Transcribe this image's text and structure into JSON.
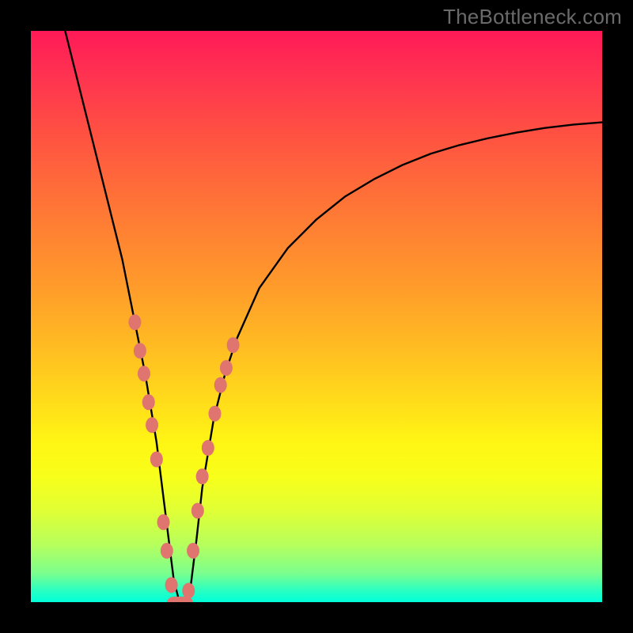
{
  "watermark": "TheBottleneck.com",
  "chart_data": {
    "type": "line",
    "title": "",
    "xlabel": "",
    "ylabel": "",
    "xlim": [
      0,
      100
    ],
    "ylim": [
      0,
      100
    ],
    "series": [
      {
        "name": "curve",
        "x": [
          6,
          8,
          10,
          12,
          14,
          16,
          18,
          19,
          20,
          21,
          22,
          23,
          24,
          25,
          26,
          27,
          28,
          29,
          30,
          32,
          34,
          36,
          40,
          45,
          50,
          55,
          60,
          65,
          70,
          75,
          80,
          85,
          90,
          95,
          100
        ],
        "y": [
          100,
          92,
          84,
          76,
          68,
          60,
          50,
          45,
          40,
          34,
          28,
          20,
          12,
          4,
          0,
          0,
          3,
          11,
          20,
          32,
          40,
          46,
          55,
          62,
          67,
          71,
          74,
          76.5,
          78.5,
          80,
          81.2,
          82.2,
          83,
          83.6,
          84
        ]
      }
    ],
    "markers_left": {
      "name": "left-markers",
      "x": [
        18.2,
        19.1,
        19.8,
        20.6,
        21.2,
        22.0,
        23.2,
        23.8,
        24.6
      ],
      "y": [
        49,
        44,
        40,
        35,
        31,
        25,
        14,
        9,
        3
      ]
    },
    "markers_right": {
      "name": "right-markers",
      "x": [
        27.6,
        28.4,
        29.2,
        30.0,
        31.0,
        32.2,
        33.2,
        34.2,
        35.4
      ],
      "y": [
        2,
        9,
        16,
        22,
        27,
        33,
        38,
        41,
        45
      ]
    },
    "markers_bottom": {
      "name": "bottom-markers",
      "x": [
        25.2,
        25.8,
        26.4,
        27.0
      ],
      "y": [
        0,
        0,
        0,
        0
      ]
    },
    "marker_color": "#e0756f",
    "curve_color": "#000000"
  }
}
